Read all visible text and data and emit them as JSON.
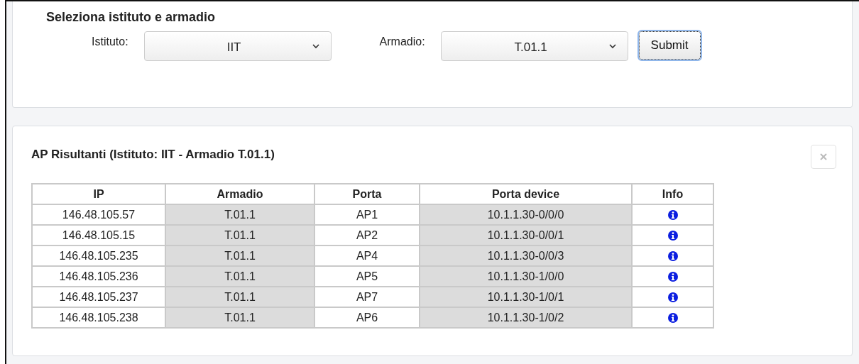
{
  "selection_panel": {
    "title": "Seleziona istituto e armadio",
    "istituto": {
      "label": "Istituto:",
      "value": "IIT"
    },
    "armadio": {
      "label": "Armadio:",
      "value": "T.01.1"
    },
    "submit_button": "Submit"
  },
  "results_panel": {
    "title": "AP Risultanti (Istituto: IIT - Armadio T.01.1)",
    "close_disabled": true,
    "table": {
      "columns": [
        "IP",
        "Armadio",
        "Porta",
        "Porta device",
        "Info"
      ],
      "rows": [
        {
          "ip": "146.48.105.57",
          "armadio": "T.01.1",
          "porta": "AP1",
          "porta_device": "10.1.1.30-0/0/0"
        },
        {
          "ip": "146.48.105.15",
          "armadio": "T.01.1",
          "porta": "AP2",
          "porta_device": "10.1.1.30-0/0/1"
        },
        {
          "ip": "146.48.105.235",
          "armadio": "T.01.1",
          "porta": "AP4",
          "porta_device": "10.1.1.30-0/0/3"
        },
        {
          "ip": "146.48.105.236",
          "armadio": "T.01.1",
          "porta": "AP5",
          "porta_device": "10.1.1.30-1/0/0"
        },
        {
          "ip": "146.48.105.237",
          "armadio": "T.01.1",
          "porta": "AP7",
          "porta_device": "10.1.1.30-1/0/1"
        },
        {
          "ip": "146.48.105.238",
          "armadio": "T.01.1",
          "porta": "AP6",
          "porta_device": "10.1.1.30-1/0/2"
        }
      ]
    }
  }
}
